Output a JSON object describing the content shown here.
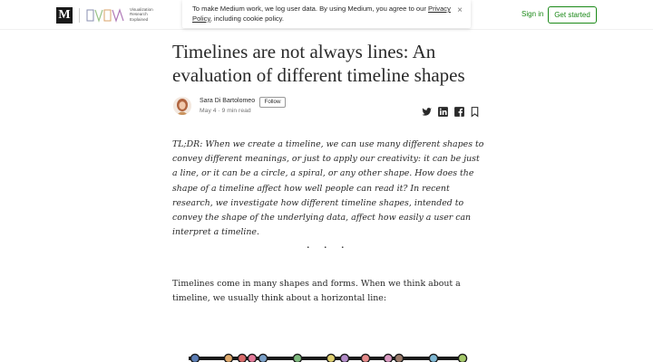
{
  "header": {
    "logo_letter": "M",
    "publication_name": "Visualization Research Explained",
    "signin_label": "Sign in",
    "get_started_label": "Get started"
  },
  "cookie_banner": {
    "text_before": "To make Medium work, we log user data. By using Medium, you agree to our ",
    "link_text": "Privacy Policy",
    "text_after": ", including cookie policy.",
    "close_glyph": "×"
  },
  "article": {
    "title": "Timelines are not always lines: An evaluation of different timeline shapes",
    "author": "Sara Di Bartolomeo",
    "follow_label": "Follow",
    "meta": "May 4 · 9 min read",
    "share_icons": [
      "twitter-icon",
      "linkedin-icon",
      "facebook-icon",
      "bookmark-icon"
    ],
    "tldr": "TL;DR: When we create a timeline, we can use many different shapes to convey different meanings, or just to apply our creativity: it can be just a line, or it can be a circle, a spiral, or any other shape. How does the shape of a timeline affect how well people can read it? In recent research, we investigate how different timeline shapes, intended to convey the shape of the underlying data, affect how easily a user can interpret a timeline.",
    "separator": ". . .",
    "paragraph": "Timelines come in many shapes and forms. When we think about a timeline, we usually think about a horizontal line:"
  },
  "timeline_dot_colors": [
    "#5b7db5",
    "#e0aa6c",
    "#d96a6a",
    "#e47a9a",
    "#7aa0c8",
    "#7fba7f",
    "#e0d070",
    "#b28bc8",
    "#e68b8b",
    "#d99ac2",
    "#9a7a6a",
    "#7fb8d4",
    "#a5c96a"
  ],
  "colors": {
    "accent_green": "#1a8917",
    "text": "#292929",
    "muted": "#757575"
  }
}
